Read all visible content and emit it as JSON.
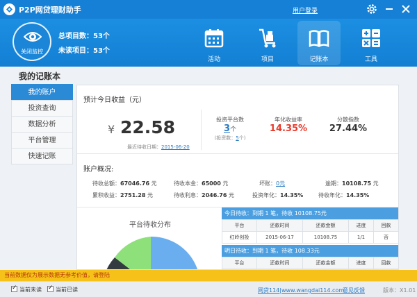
{
  "app": {
    "title": "P2P网贷理财助手",
    "login_label": "用户登录"
  },
  "header": {
    "monitor_label": "关闭监控",
    "total_projects": "总项目数：53个",
    "unread_projects": "未读项目：53个"
  },
  "nav": {
    "tabs": [
      {
        "label": "活动",
        "icon": "calendar-icon",
        "active": false
      },
      {
        "label": "项目",
        "icon": "cart-icon",
        "active": false
      },
      {
        "label": "记账本",
        "icon": "book-icon",
        "active": true
      },
      {
        "label": "工具",
        "icon": "calculator-icon",
        "active": false
      }
    ]
  },
  "page": {
    "title": "我的记账本"
  },
  "sidebar": {
    "items": [
      {
        "label": "我的账户",
        "active": true
      },
      {
        "label": "投资查询",
        "active": false
      },
      {
        "label": "数据分析",
        "active": false
      },
      {
        "label": "平台管理",
        "active": false
      },
      {
        "label": "快速记账",
        "active": false
      }
    ]
  },
  "earnings": {
    "section_title": "预计今日收益（元）",
    "currency": "¥",
    "amount": "22.58",
    "recent_date_label": "最近待收日期：",
    "recent_date": "2015-06-20",
    "platform_count_label": "投资平台数",
    "platform_count": "3",
    "platform_unit": "个",
    "invested_prefix": "(投资数：",
    "invested_count": "5",
    "invested_suffix": "个)",
    "annual_label": "年化收益率",
    "annual_value": "14.35%",
    "dispersion_label": "分散指数",
    "dispersion_value": "27.44%"
  },
  "overview": {
    "title": "账户概况:",
    "rows": [
      [
        {
          "label": "待收总额：",
          "value": "67046.76",
          "unit": "元"
        },
        {
          "label": "待收本金：",
          "value": "65000",
          "unit": "元"
        },
        {
          "label": "坏账：",
          "value": "0元",
          "unit": "",
          "link": true
        },
        {
          "label": "逾期：",
          "value": "10108.75",
          "unit": "元"
        }
      ],
      [
        {
          "label": "累积收益：",
          "value": "2751.28",
          "unit": "元"
        },
        {
          "label": "待收利息：",
          "value": "2046.76",
          "unit": "元"
        },
        {
          "label": "投资年化：",
          "value": "14.35%",
          "unit": ""
        },
        {
          "label": "待收年化：",
          "value": "14.35%",
          "unit": ""
        }
      ]
    ]
  },
  "chart_data": {
    "type": "pie",
    "title": "平台待收分布",
    "colors": [
      "#6aaef0",
      "#333a40",
      "#8ee07a"
    ]
  },
  "today_due": {
    "title": "今日待收：到期 1 笔，待收 10108.75元",
    "columns": [
      "平台",
      "还款时间",
      "还款金额",
      "进度",
      "回款"
    ],
    "rows": [
      [
        "红岭创投",
        "2015-06-17",
        "10108.75",
        "1/1",
        "否"
      ]
    ]
  },
  "tomorrow_due": {
    "title": "明日待收：到期 1 笔，待收 108.33元",
    "columns": [
      "平台",
      "还款时间",
      "还款金额",
      "进度",
      "回款"
    ]
  },
  "notice": {
    "text": "当前数据仅为展示数据无参考价值，请登陆"
  },
  "status": {
    "check_unread": "当前未读",
    "check_read": "当前已读",
    "site_link": "网贷114|www.wangdai114.com",
    "feedback_link": "意见反馈",
    "version": "版本：X1.01"
  },
  "colors": {
    "brand": "#1580d6",
    "accent_red": "#e8392b",
    "notice_bg": "#f6c21a",
    "active_tab": "#2a8ad6"
  }
}
